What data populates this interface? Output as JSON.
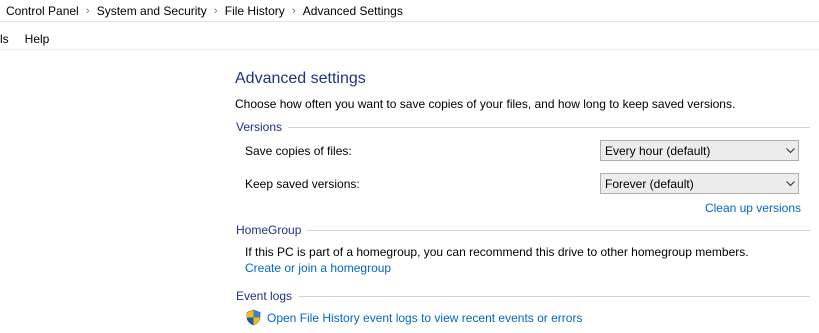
{
  "breadcrumb": {
    "items": [
      "Control Panel",
      "System and Security",
      "File History",
      "Advanced Settings"
    ],
    "separator": ">"
  },
  "menu": {
    "items": [
      "ls",
      "Help"
    ]
  },
  "page": {
    "title": "Advanced settings",
    "description": "Choose how often you want to save copies of your files, and how long to keep saved versions."
  },
  "versions": {
    "header": "Versions",
    "save_copies_label": "Save copies of files:",
    "save_copies_value": "Every hour (default)",
    "keep_versions_label": "Keep saved versions:",
    "keep_versions_value": "Forever (default)",
    "clean_up_link": "Clean up versions"
  },
  "homegroup": {
    "header": "HomeGroup",
    "text": "If this PC is part of a homegroup, you can recommend this drive to other homegroup members.",
    "link": "Create or join a homegroup"
  },
  "event_logs": {
    "header": "Event logs",
    "link": "Open File History event logs to view recent events or errors"
  },
  "colors": {
    "heading_blue": "#1e3287",
    "link_blue": "#0066cc"
  }
}
